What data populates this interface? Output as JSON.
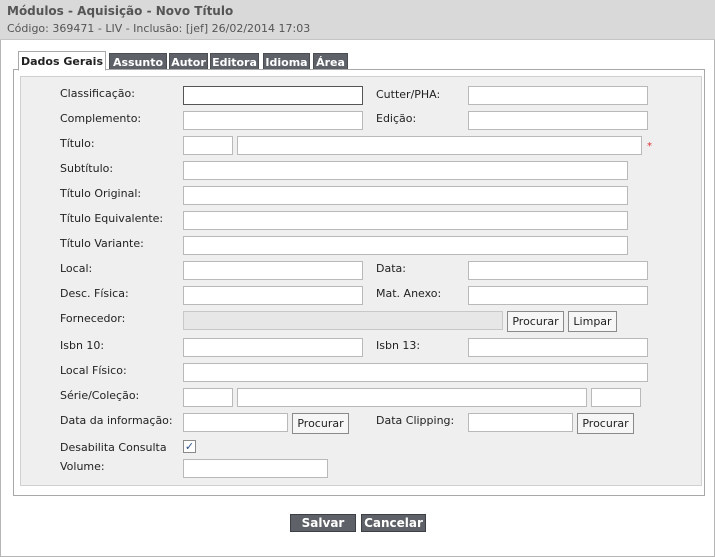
{
  "header": {
    "title": "Módulos - Aquisição - Novo Título",
    "subtitle": "Código: 369471 - LIV - Inclusão: [jef] 26/02/2014 17:03"
  },
  "tabs": [
    "Dados Gerais",
    "Assunto",
    "Autor",
    "Editora",
    "Idioma",
    "Área"
  ],
  "active_tab": "Dados Gerais",
  "form": {
    "classificacao": "Classificação:",
    "cutter": "Cutter/PHA:",
    "complemento": "Complemento:",
    "edicao": "Edição:",
    "titulo": "Título:",
    "required_mark": "*",
    "subtitulo": "Subtítulo:",
    "titulo_original": "Título Original:",
    "titulo_equivalente": "Título Equivalente:",
    "titulo_variante": "Título Variante:",
    "local": "Local:",
    "data": "Data:",
    "desc_fisica": "Desc. Física:",
    "mat_anexo": "Mat. Anexo:",
    "fornecedor": "Fornecedor:",
    "procurar": "Procurar",
    "limpar": "Limpar",
    "isbn10": "Isbn 10:",
    "isbn13": "Isbn 13:",
    "local_fisico": "Local Físico:",
    "serie_colecao": "Série/Coleção:",
    "data_informacao": "Data da informação:",
    "data_clipping": "Data Clipping:",
    "desabilita_consulta": "Desabilita Consulta",
    "desabilita_checked": true,
    "volume": "Volume:"
  },
  "actions": {
    "salvar": "Salvar",
    "cancelar": "Cancelar"
  }
}
